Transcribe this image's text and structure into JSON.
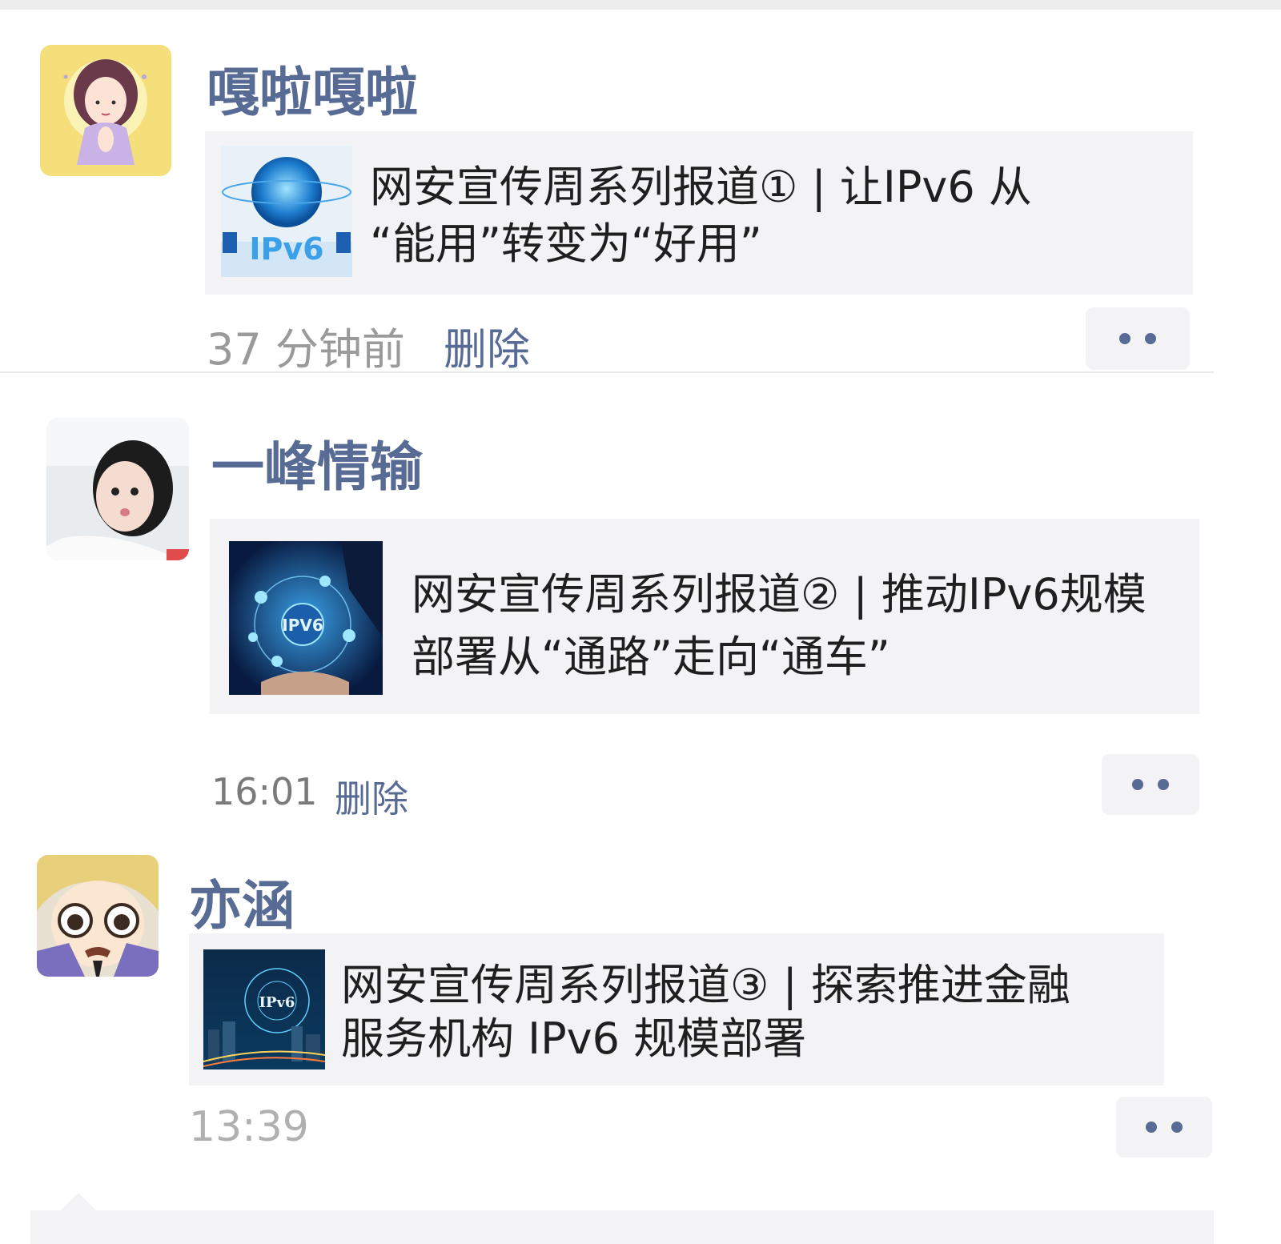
{
  "posts": [
    {
      "author": "嘎啦嘎啦",
      "avatar_icon": "cartoon-girl-avatar",
      "thumbnail_icon": "ipv6-globe-thumbnail",
      "thumbnail_text": "IPv6",
      "title_line1": "网安宣传周系列报道① | 让IPv6 从",
      "title_line2": "“能用”转变为“好用”",
      "time": "37 分钟前",
      "delete_label": "删除"
    },
    {
      "author": "一峰情输",
      "avatar_icon": "girl-photo-avatar",
      "thumbnail_icon": "ipv6-network-hand-thumbnail",
      "thumbnail_text": "IPV6",
      "title_line1": "网安宣传周系列报道② | 推动IPv6规模",
      "title_line2": "部署从“通路”走向“通车”",
      "time": "16:01",
      "delete_label": "删除"
    },
    {
      "author": "亦涵",
      "avatar_icon": "anime-boy-avatar",
      "thumbnail_icon": "ipv6-city-network-thumbnail",
      "thumbnail_text": "IPv6",
      "title_line1": "网安宣传周系列报道③ | 探索推进金融",
      "title_line2": "服务机构 IPv6 规模部署",
      "time": "13:39"
    }
  ],
  "colors": {
    "author_name": "#576b95",
    "link_blue": "#576b95",
    "card_bg": "#f3f3f5",
    "time_gray": "#9a9a9a"
  },
  "more_icon": "more-dots-icon"
}
